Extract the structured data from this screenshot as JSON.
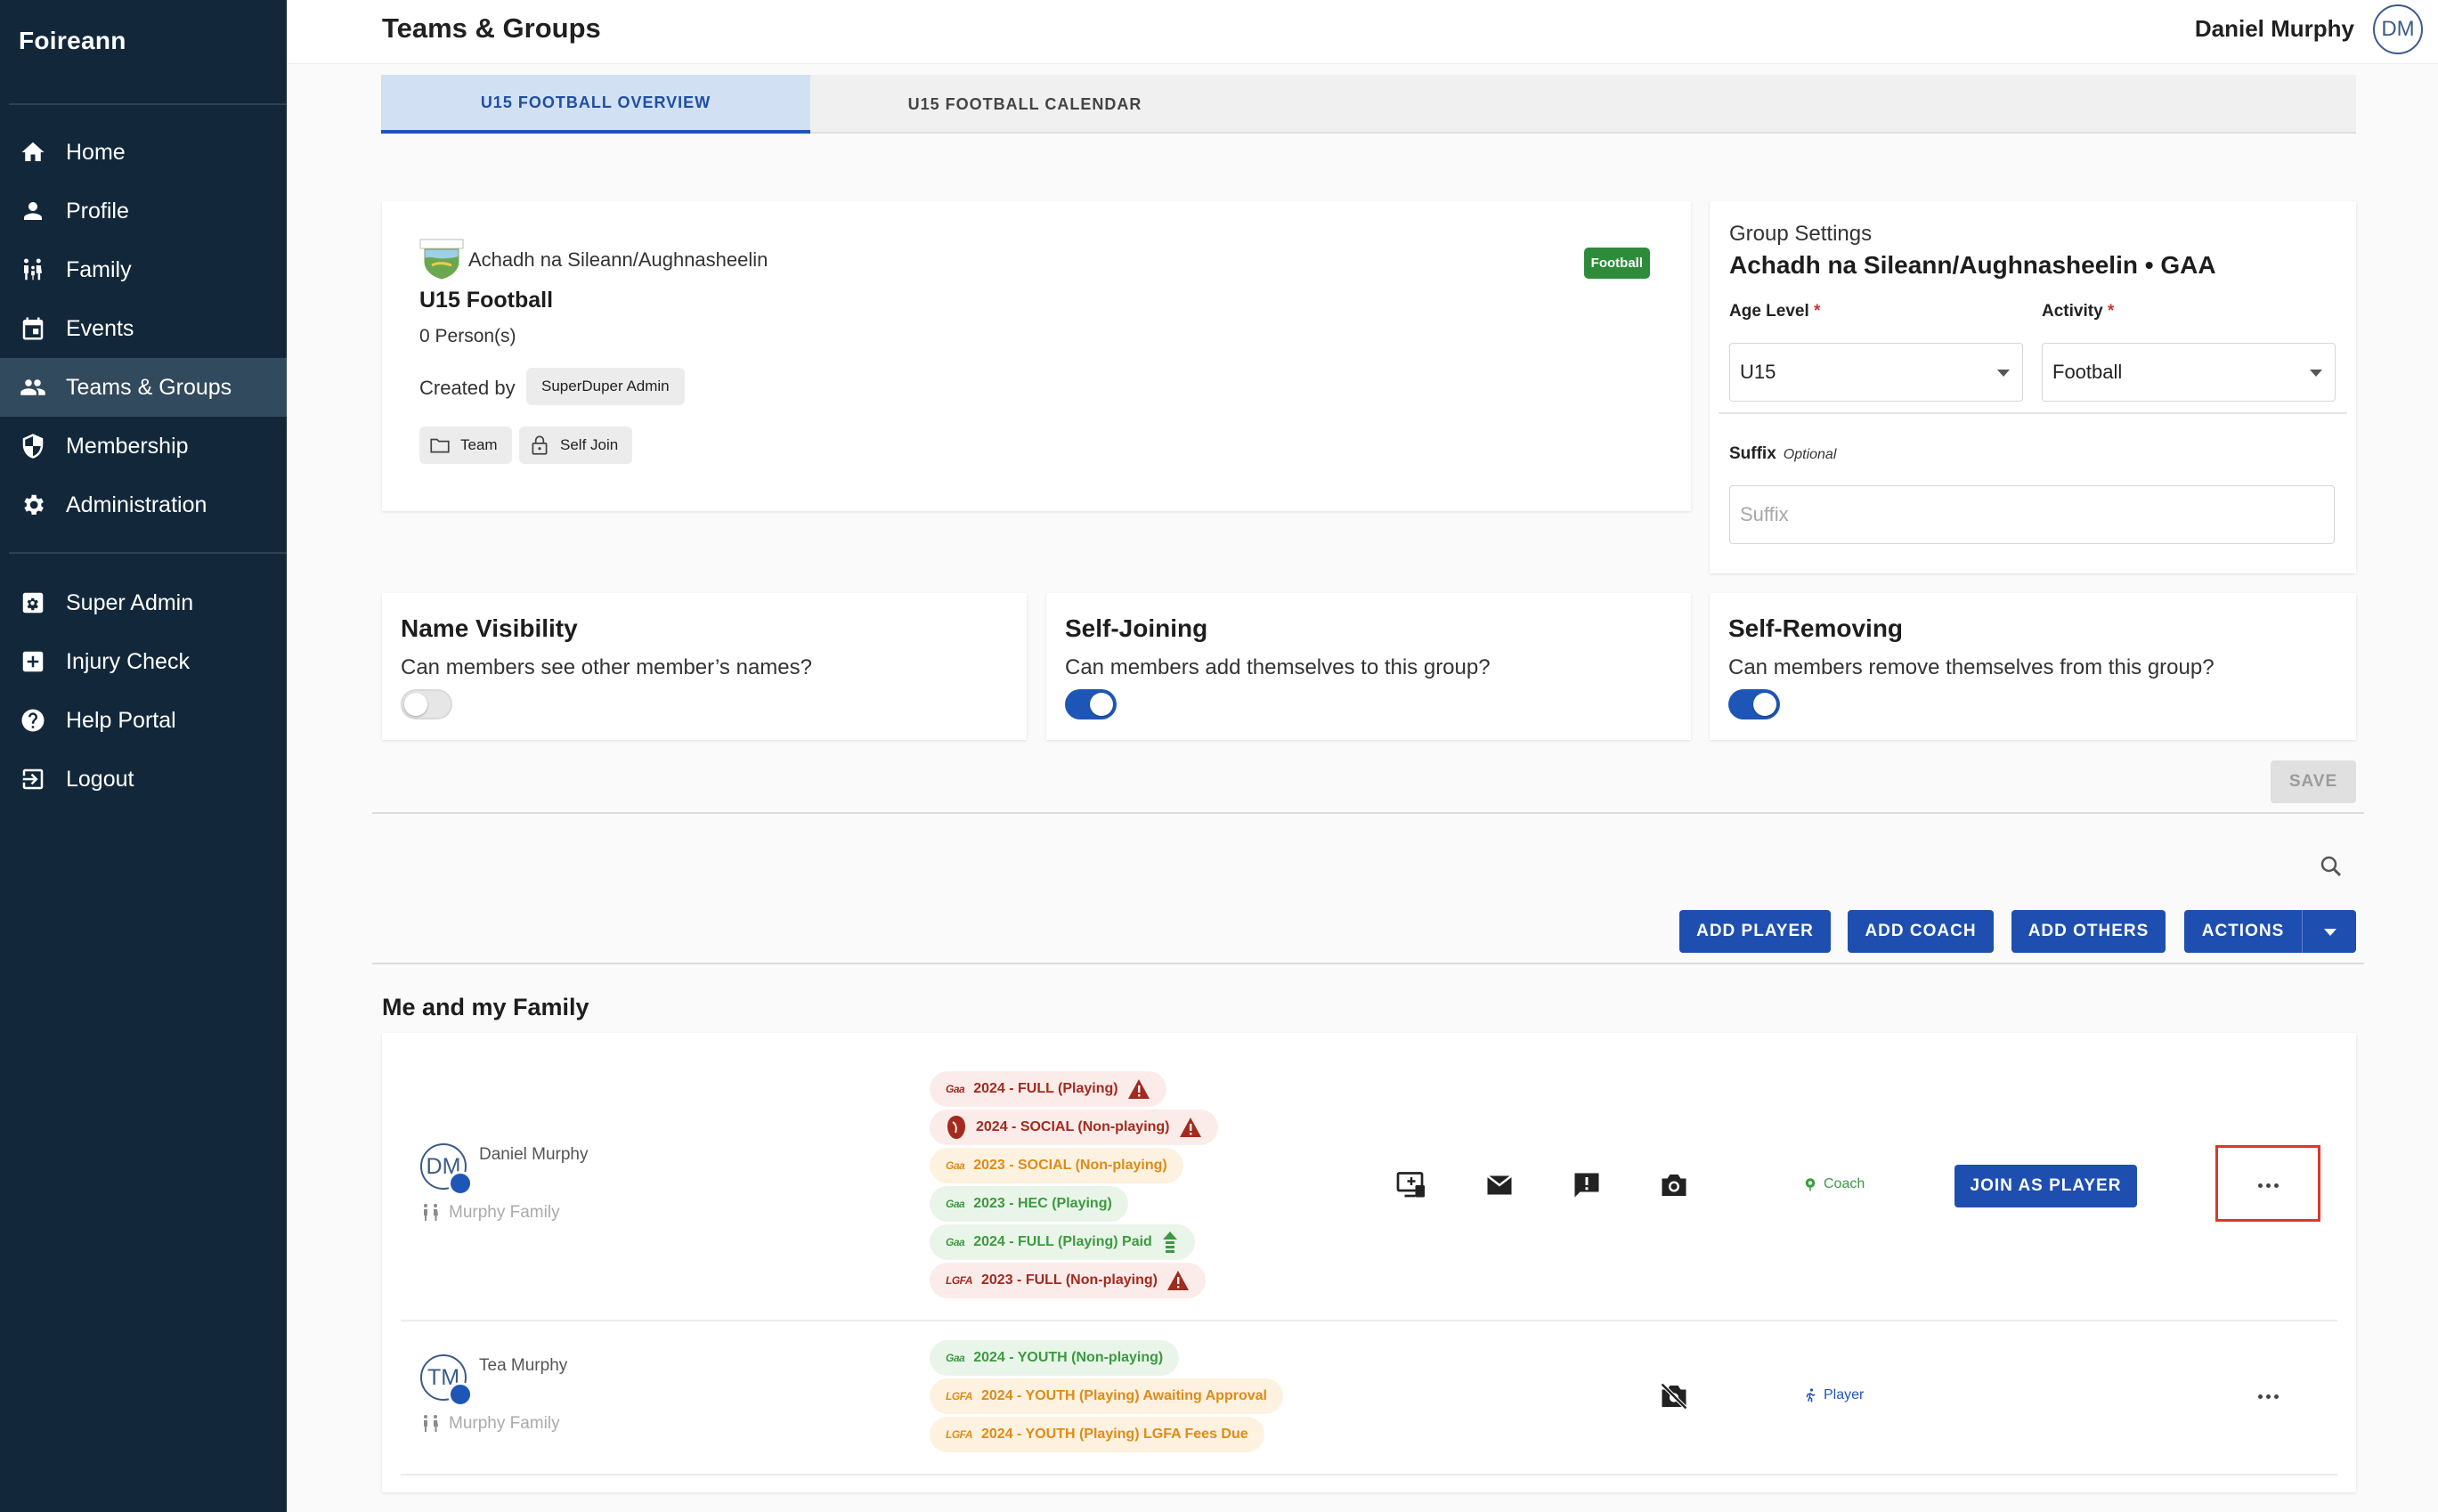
{
  "app": {
    "brand": "Foireann"
  },
  "sidebar": {
    "items": [
      {
        "label": "Home",
        "icon": "home-icon"
      },
      {
        "label": "Profile",
        "icon": "person-icon"
      },
      {
        "label": "Family",
        "icon": "family-icon"
      },
      {
        "label": "Events",
        "icon": "calendar-icon"
      },
      {
        "label": "Teams & Groups",
        "icon": "group-icon",
        "active": true
      },
      {
        "label": "Membership",
        "icon": "shield-icon"
      },
      {
        "label": "Administration",
        "icon": "gear-icon"
      }
    ],
    "secondary": [
      {
        "label": "Super Admin",
        "icon": "admin-gear-icon"
      },
      {
        "label": "Injury Check",
        "icon": "medical-cross-icon"
      },
      {
        "label": "Help Portal",
        "icon": "help-icon"
      },
      {
        "label": "Logout",
        "icon": "logout-icon"
      }
    ]
  },
  "header": {
    "title": "Teams & Groups",
    "user_name": "Daniel Murphy",
    "user_initials": "DM"
  },
  "tabs": [
    {
      "label": "U15 FOOTBALL OVERVIEW",
      "active": true
    },
    {
      "label": "U15 FOOTBALL CALENDAR",
      "active": false
    }
  ],
  "group": {
    "club": "Achadh na Sileann/Aughnasheelin",
    "name": "U15 Football",
    "persons": "0 Person(s)",
    "created_by_label": "Created by",
    "created_by": "SuperDuper Admin",
    "chips": [
      "Team",
      "Self Join"
    ],
    "activity_badge": "Football"
  },
  "settings": {
    "title": "Group Settings",
    "club_line": "Achadh na Sileann/Aughnasheelin • GAA",
    "age_label": "Age Level",
    "age_value": "U15",
    "activity_label": "Activity",
    "activity_value": "Football",
    "required_mark": "*",
    "suffix_label": "Suffix",
    "suffix_optional": "Optional",
    "suffix_placeholder": "Suffix"
  },
  "toggles": [
    {
      "title": "Name Visibility",
      "question": "Can members see other member’s names?",
      "on": false
    },
    {
      "title": "Self-Joining",
      "question": "Can members add themselves to this group?",
      "on": true
    },
    {
      "title": "Self-Removing",
      "question": "Can members remove themselves from this group?",
      "on": true
    }
  ],
  "actions": {
    "save": "SAVE",
    "add_player": "ADD PLAYER",
    "add_coach": "ADD COACH",
    "add_others": "ADD OTHERS",
    "actions": "ACTIONS"
  },
  "family_section": {
    "title": "Me and my Family"
  },
  "members": [
    {
      "initials": "DM",
      "name": "Daniel Murphy",
      "family": "Murphy Family",
      "role": "Coach",
      "join_label": "JOIN AS PLAYER",
      "memberships": [
        {
          "logo": "Gaa",
          "text": "2024 - FULL (Playing)",
          "status": "red",
          "warn": true
        },
        {
          "logo": "crest",
          "text": "2024 - SOCIAL (Non-playing)",
          "status": "red",
          "warn": true
        },
        {
          "logo": "Gaa",
          "text": "2023 - SOCIAL (Non-playing)",
          "status": "orange"
        },
        {
          "logo": "Gaa",
          "text": "2023 - HEC (Playing)",
          "status": "green"
        },
        {
          "logo": "Gaa",
          "text": "2024 - FULL (Playing) Paid",
          "status": "green",
          "upgrade": true
        },
        {
          "logo": "LGFA",
          "text": "2023 - FULL (Non-playing)",
          "status": "red",
          "warn": true
        }
      ]
    },
    {
      "initials": "TM",
      "name": "Tea Murphy",
      "family": "Murphy Family",
      "role": "Player",
      "memberships": [
        {
          "logo": "Gaa",
          "text": "2024 - YOUTH (Non-playing)",
          "status": "green"
        },
        {
          "logo": "LGFA",
          "text": "2024 - YOUTH (Playing) Awaiting Approval",
          "status": "orange"
        },
        {
          "logo": "LGFA",
          "text": "2024 - YOUTH (Playing) LGFA Fees Due",
          "status": "orange"
        }
      ]
    }
  ],
  "colors": {
    "sidebar": "#12283a",
    "primary": "#1e4fb0",
    "highlight": "#e0362a"
  }
}
